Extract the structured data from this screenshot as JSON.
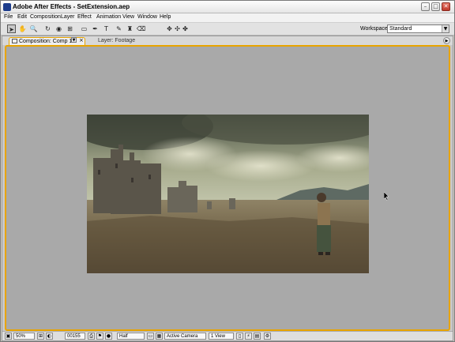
{
  "window": {
    "title": "Adobe After Effects - SetExtension.aep",
    "minimize": "–",
    "maximize": "□",
    "close": "✕"
  },
  "menu": [
    "File",
    "Edit",
    "Composition",
    "Layer",
    "Effect",
    "Animation",
    "View",
    "Window",
    "Help"
  ],
  "toolbar": {
    "tools": [
      {
        "name": "selection-tool-icon",
        "glyph": "➤"
      },
      {
        "name": "hand-tool-icon",
        "glyph": "✋"
      },
      {
        "name": "zoom-tool-icon",
        "glyph": "🔍"
      },
      {
        "name": "rotation-tool-icon",
        "glyph": "↻"
      },
      {
        "name": "orbit-camera-tool-icon",
        "glyph": "◉"
      },
      {
        "name": "pan-behind-tool-icon",
        "glyph": "⊞"
      },
      {
        "name": "mask-tool-icon",
        "glyph": "▭"
      },
      {
        "name": "pen-tool-icon",
        "glyph": "✒"
      },
      {
        "name": "type-tool-icon",
        "glyph": "T"
      },
      {
        "name": "brush-tool-icon",
        "glyph": "✎"
      },
      {
        "name": "clone-stamp-tool-icon",
        "glyph": "♜"
      },
      {
        "name": "eraser-tool-icon",
        "glyph": "⌫"
      },
      {
        "name": "local-axis-icon",
        "glyph": "✥"
      },
      {
        "name": "world-axis-icon",
        "glyph": "✣"
      },
      {
        "name": "view-axis-icon",
        "glyph": "✤"
      }
    ],
    "workspace_label": "Workspace:",
    "workspace_value": "Standard"
  },
  "tabs": {
    "composition": "Composition: Comp 1",
    "layer": "Layer: Footage",
    "menu_arrow": "▼",
    "close": "×",
    "panel_menu": "▶"
  },
  "viewer": {
    "magnification": "50%",
    "timecode": "00155",
    "resolution": "Half",
    "camera": "Active Camera",
    "views": "1 View",
    "dropdown_arrow": "▼"
  },
  "colors": {
    "accent": "#e8a400",
    "panel_bg": "#a9a9a9",
    "chrome": "#d4d0c8"
  }
}
